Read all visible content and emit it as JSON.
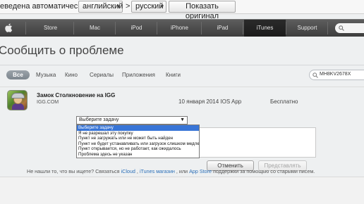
{
  "translate_bar": {
    "status_text": "еведена автоматически",
    "source_lang": "английский",
    "direction": ">",
    "target_lang": "русский",
    "show_original": "Показать оригинал"
  },
  "global_nav": {
    "items": [
      "Store",
      "Mac",
      "iPod",
      "iPhone",
      "iPad",
      "iTunes",
      "Support"
    ],
    "active": "iTunes"
  },
  "page": {
    "title": "Сообщить о проблеме",
    "filters": [
      "Все",
      "Музыка",
      "Кино",
      "Сериалы",
      "Приложения",
      "Книги"
    ],
    "search_value": "MH8KV2678X"
  },
  "app": {
    "name": "Замок Столкновение на IGG",
    "developer": "IGG.COM",
    "date_type": "10 января 2014 IOS App",
    "price": "Бесплатно"
  },
  "problem_select": {
    "selected": "Выберите задачу",
    "arrow": "▼",
    "options": [
      "Выберите задачу",
      "Я не разрешал эту покупку",
      "Пункт не загружать или не может быть найден",
      "Пункт не будет устанавливать или загрузок слишком медленно",
      "Пункт открывается, но не работает, как ожидалось",
      "Проблема здесь не указан"
    ],
    "highlighted_index": 0
  },
  "buttons": {
    "cancel": "Отменить",
    "submit": "Представлять"
  },
  "footer": {
    "prefix": "Не нашли то, что вы ищете? Связаться ",
    "link1": "iCloud",
    "sep1": " , ",
    "link2": "iTunes магазин",
    "sep2": " , или ",
    "link3": "App Store",
    "suffix": " поддержки за помощью со старыми писем."
  },
  "colors": {
    "nav_bg": "#4a4a4a",
    "link": "#2b6fb8",
    "highlight": "#3875d7"
  }
}
